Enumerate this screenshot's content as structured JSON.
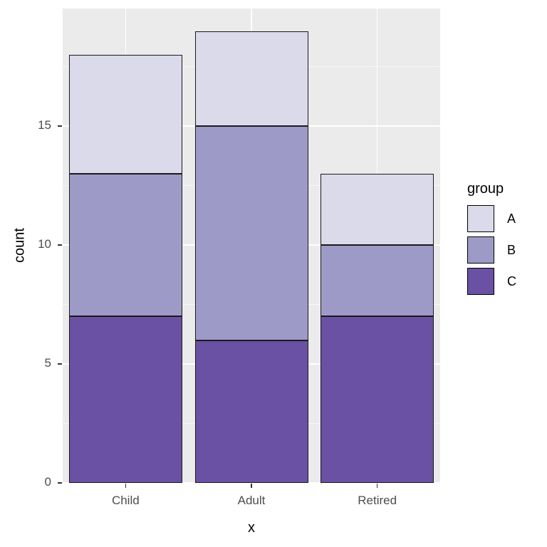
{
  "chart_data": {
    "type": "bar",
    "stacked": true,
    "title": "",
    "subtitle": "",
    "xlabel": "x",
    "ylabel": "count",
    "categories": [
      "Child",
      "Adult",
      "Retired"
    ],
    "series": [
      {
        "name": "C",
        "values": [
          7,
          6,
          7
        ],
        "color": "#6a51a3"
      },
      {
        "name": "B",
        "values": [
          6,
          9,
          3
        ],
        "color": "#9e9ac8"
      },
      {
        "name": "A",
        "values": [
          5,
          4,
          3
        ],
        "color": "#dadaeb"
      }
    ],
    "stack_totals": [
      18,
      19,
      13
    ],
    "stack_boundaries": {
      "Child": [
        0,
        7,
        13,
        18
      ],
      "Adult": [
        0,
        6,
        15,
        19
      ],
      "Retired": [
        0,
        7,
        10,
        13
      ]
    },
    "ylim": [
      0,
      19.95
    ],
    "yticks": [
      0,
      5,
      10,
      15
    ],
    "ytick_labels": [
      "0",
      "5",
      "10",
      "15"
    ],
    "yminor_ticks": [
      2.5,
      7.5,
      12.5,
      17.5
    ],
    "xticks": [
      "Child",
      "Adult",
      "Retired"
    ],
    "grid": true,
    "legend": {
      "title": "group",
      "position": "right",
      "entries": [
        {
          "label": "A",
          "color": "#dadaeb"
        },
        {
          "label": "B",
          "color": "#9e9ac8"
        },
        {
          "label": "C",
          "color": "#6a51a3"
        }
      ]
    },
    "theme": {
      "panel_background": "#ebebeb",
      "plot_background": "#ffffff",
      "gridline_major_color": "#ffffff",
      "gridline_minor_color": "#f7f7f7",
      "axis_text_color": "#4d4d4d",
      "axis_title_color": "#000000",
      "bar_outline_color": "#1a1a1a"
    }
  }
}
